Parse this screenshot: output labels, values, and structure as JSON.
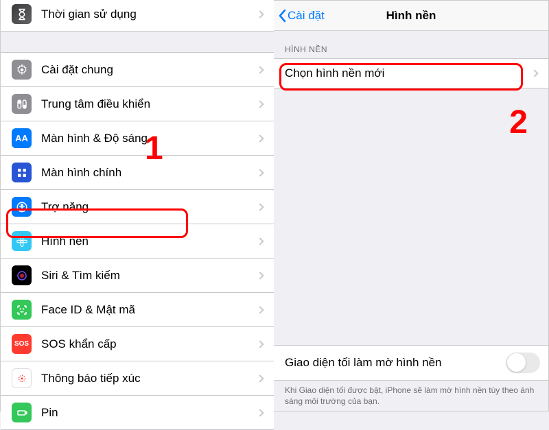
{
  "left": {
    "rows": [
      {
        "label": "Thời gian sử dụng"
      },
      {
        "label": "Cài đặt chung"
      },
      {
        "label": "Trung tâm điều khiển"
      },
      {
        "label": "Màn hình & Độ sáng"
      },
      {
        "label": "Màn hình chính"
      },
      {
        "label": "Trợ năng"
      },
      {
        "label": "Hình nền"
      },
      {
        "label": "Siri & Tìm kiếm"
      },
      {
        "label": "Face ID & Mật mã"
      },
      {
        "label": "SOS khẩn cấp"
      },
      {
        "label": "Thông báo tiếp xúc"
      },
      {
        "label": "Pin"
      }
    ]
  },
  "right": {
    "back": "Cài đặt",
    "title": "Hình nền",
    "section": "HÌNH NỀN",
    "choose": "Chọn hình nền mới",
    "dim_label": "Giao diện tối làm mờ hình nền",
    "footer": "Khi Giao diện tối được bật, iPhone sẽ làm mờ hình nền tùy theo ánh sáng môi trường của bạn."
  },
  "annot": {
    "one": "1",
    "two": "2"
  }
}
